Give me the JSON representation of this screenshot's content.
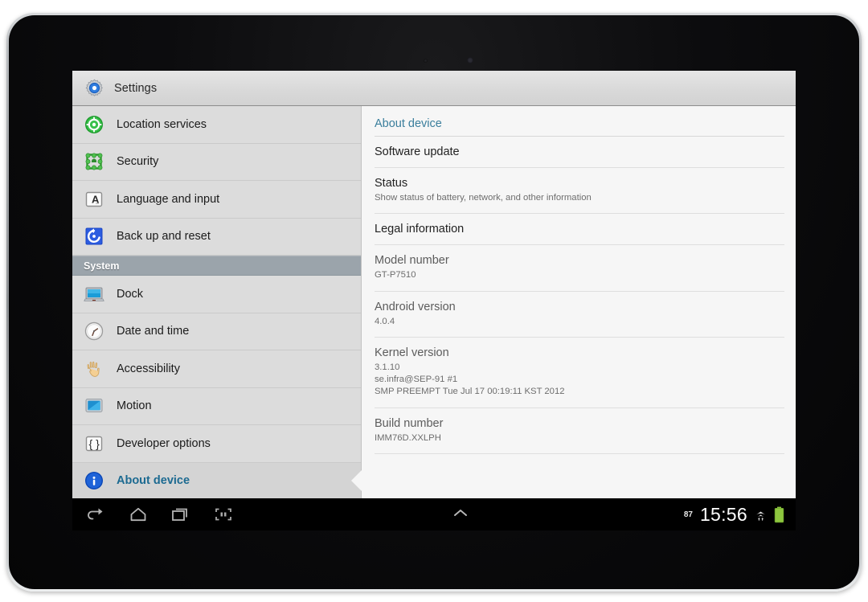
{
  "device": {
    "kind": "android-tablet"
  },
  "app": {
    "icon": "settings-gear-icon",
    "title": "Settings"
  },
  "sidebar": {
    "items": [
      {
        "id": "location-services",
        "label": "Location services",
        "icon": "location-target-icon",
        "type": "item",
        "selected": false
      },
      {
        "id": "security",
        "label": "Security",
        "icon": "security-grid-icon",
        "type": "item",
        "selected": false
      },
      {
        "id": "language-and-input",
        "label": "Language and input",
        "icon": "letter-a-icon",
        "type": "item",
        "selected": false
      },
      {
        "id": "back-up-and-reset",
        "label": "Back up and reset",
        "icon": "restore-arrow-icon",
        "type": "item",
        "selected": false
      },
      {
        "id": "system-header",
        "label": "System",
        "icon": "",
        "type": "header",
        "selected": false
      },
      {
        "id": "dock",
        "label": "Dock",
        "icon": "monitor-icon",
        "type": "item",
        "selected": false
      },
      {
        "id": "date-and-time",
        "label": "Date and time",
        "icon": "clock-icon",
        "type": "item",
        "selected": false
      },
      {
        "id": "accessibility",
        "label": "Accessibility",
        "icon": "hand-icon",
        "type": "item",
        "selected": false
      },
      {
        "id": "motion",
        "label": "Motion",
        "icon": "screen-tilt-icon",
        "type": "item",
        "selected": false
      },
      {
        "id": "developer-options",
        "label": "Developer options",
        "icon": "curly-braces-icon",
        "type": "item",
        "selected": false
      },
      {
        "id": "about-device",
        "label": "About device",
        "icon": "info-circle-icon",
        "type": "item",
        "selected": true
      }
    ]
  },
  "content": {
    "title": "About device",
    "rows": [
      {
        "id": "software-update",
        "title": "Software update",
        "summary": "",
        "muted": false
      },
      {
        "id": "status",
        "title": "Status",
        "summary": "Show status of battery, network, and other information",
        "muted": false
      },
      {
        "id": "legal-information",
        "title": "Legal information",
        "summary": "",
        "muted": false
      },
      {
        "id": "model-number",
        "title": "Model number",
        "summary": "GT-P7510",
        "muted": true
      },
      {
        "id": "android-version",
        "title": "Android version",
        "summary": "4.0.4",
        "muted": true
      },
      {
        "id": "kernel-version",
        "title": "Kernel version",
        "summary": "3.1.10\nse.infra@SEP-91 #1\nSMP PREEMPT Tue Jul 17 00:19:11 KST 2012",
        "muted": true
      },
      {
        "id": "build-number",
        "title": "Build number",
        "summary": "IMM76D.XXLPH",
        "muted": true
      }
    ]
  },
  "system_bar": {
    "back_icon": "back-arrow-icon",
    "home_icon": "home-icon",
    "recents_icon": "recent-apps-icon",
    "screenshot_icon": "screenshot-capture-icon",
    "expand_icon": "chevron-up-icon",
    "battery_percent": "87",
    "clock": "15:56",
    "wifi_icon": "wifi-icon",
    "battery_icon": "battery-full-icon"
  },
  "colors": {
    "accent_blue": "#3a7e9c",
    "selected_label": "#1c6a91",
    "section_header_bg": "#9ba4ab",
    "sidebar_bg": "#dcdcdc",
    "content_bg": "#f6f6f6",
    "battery_green": "#82c341"
  }
}
